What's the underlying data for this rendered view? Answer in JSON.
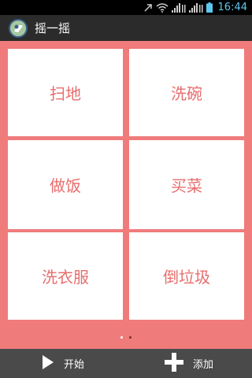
{
  "status_bar": {
    "time": "16:44"
  },
  "title_bar": {
    "title": "摇一摇",
    "icon": "app-logo-icon"
  },
  "tasks": [
    {
      "label": "扫地"
    },
    {
      "label": "洗碗"
    },
    {
      "label": "做饭"
    },
    {
      "label": "买菜"
    },
    {
      "label": "洗衣服"
    },
    {
      "label": "倒垃圾"
    }
  ],
  "pager": {
    "current_page": 1,
    "page_count": 2
  },
  "bottom_bar": {
    "start_label": "开始",
    "start_icon": "play-icon",
    "add_label": "添加",
    "add_icon": "plus-icon"
  },
  "colors": {
    "background": "#f07b7b",
    "task_text": "#e86d6d",
    "time": "#5ec7f0"
  }
}
